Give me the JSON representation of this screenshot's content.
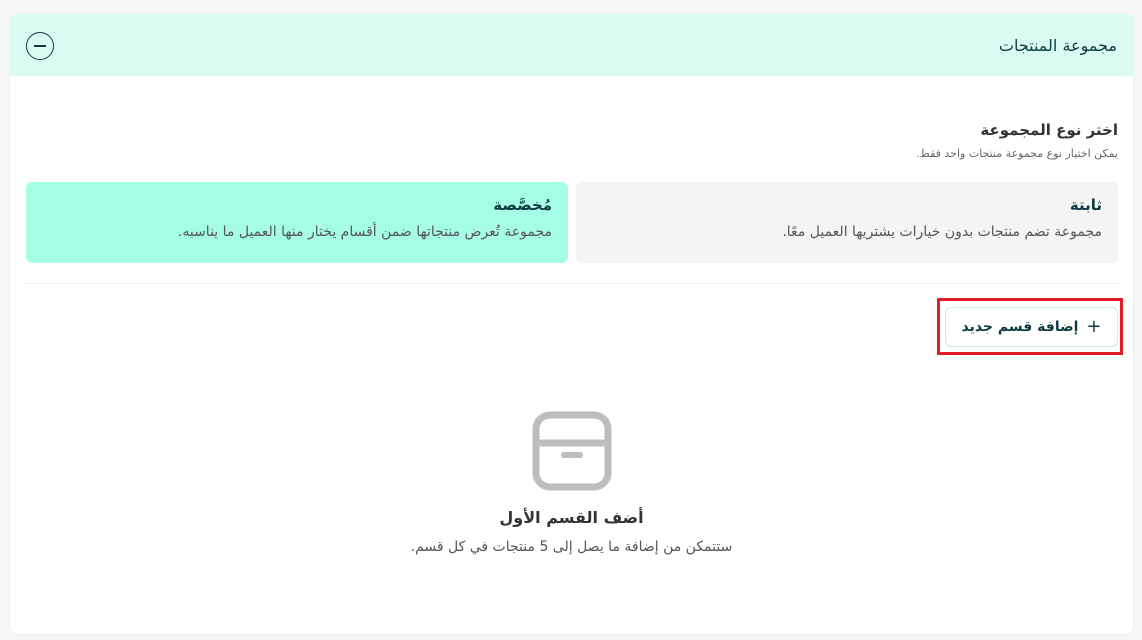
{
  "header": {
    "title": "مجموعة المنتجات"
  },
  "group_type": {
    "title": "اختر نوع المجموعة",
    "hint": "يمكن اختيار نوع مجموعة منتجات واحد فقط.",
    "options": [
      {
        "title": "ثابتة",
        "description": "مجموعة تضم منتجات بدون خيارات يشتريها العميل معًا.",
        "selected": false
      },
      {
        "title": "مُخصَّصة",
        "description": "مجموعة تُعرض منتجاتها ضمن أقسام يختار منها العميل ما يناسبه.",
        "selected": true
      }
    ]
  },
  "actions": {
    "add_section_label": "إضافة قسم جديد",
    "add_section_icon": "plus-icon"
  },
  "empty_state": {
    "icon": "box-icon",
    "title": "أضف القسم الأول",
    "description": "ستتمكن من إضافة ما يصل إلى 5 منتجات في كل قسم."
  },
  "colors": {
    "header_bg": "#d9fbf2",
    "selected_option_bg": "#a6fde5",
    "unselected_option_bg": "#f4f4f4",
    "highlight": "#e11d2a",
    "text_dark": "#0e3b43"
  }
}
